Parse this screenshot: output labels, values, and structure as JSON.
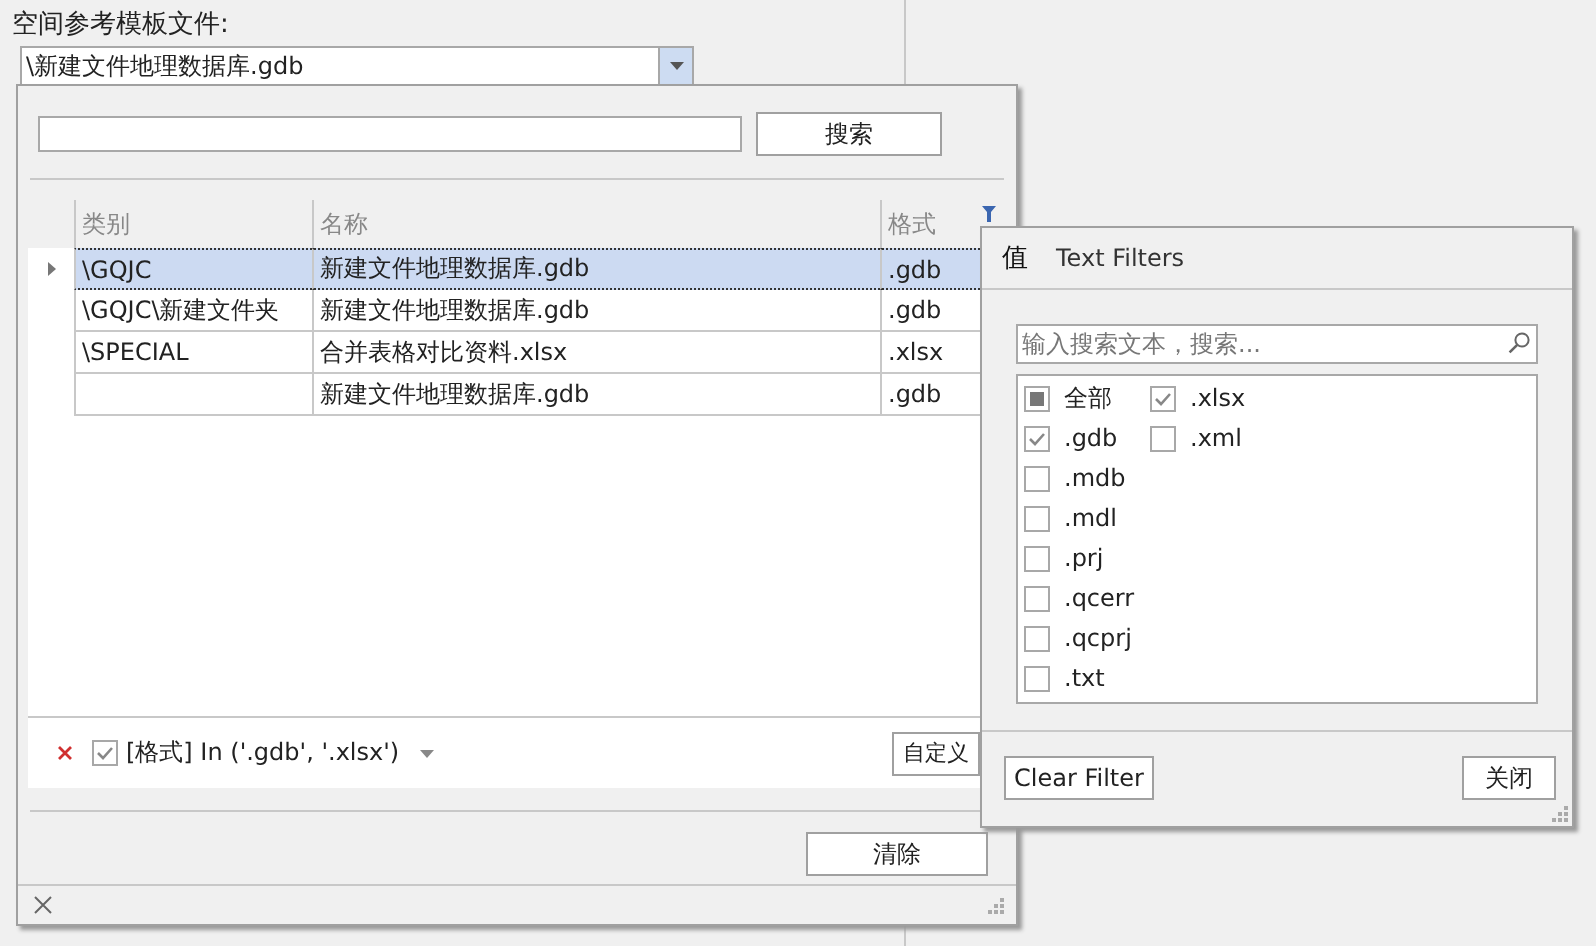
{
  "form": {
    "label": "空间参考模板文件:",
    "combo_value": "\\新建文件地理数据库.gdb"
  },
  "dropdown": {
    "search": {
      "button": "搜索"
    },
    "table": {
      "columns": [
        {
          "label": "类别",
          "filtered": false
        },
        {
          "label": "名称",
          "filtered": false
        },
        {
          "label": "格式",
          "filtered": true
        }
      ],
      "rows": [
        {
          "cells": [
            "\\GQJC",
            "新建文件地理数据库.gdb",
            ".gdb"
          ],
          "selected": true
        },
        {
          "cells": [
            "\\GQJC\\新建文件夹",
            "新建文件地理数据库.gdb",
            ".gdb"
          ],
          "selected": false
        },
        {
          "cells": [
            "\\SPECIAL",
            "合并表格对比资料.xlsx",
            ".xlsx"
          ],
          "selected": false
        },
        {
          "cells": [
            "",
            "新建文件地理数据库.gdb",
            ".gdb"
          ],
          "selected": false
        }
      ]
    },
    "filter_bar": {
      "enabled": true,
      "expression": "[格式] In ('.gdb', '.xlsx')",
      "customize_button": "自定义"
    },
    "clear_button": "清除"
  },
  "filter_popup": {
    "tabs": [
      {
        "label": "值",
        "selected": true
      },
      {
        "label": "Text Filters",
        "selected": false
      }
    ],
    "search_placeholder": "输入搜索文本，搜索...",
    "values": [
      {
        "label": "全部",
        "checked": false,
        "partial": true
      },
      {
        "label": ".gdb",
        "checked": true,
        "partial": false
      },
      {
        "label": ".mdb",
        "checked": false,
        "partial": false
      },
      {
        "label": ".mdl",
        "checked": false,
        "partial": false
      },
      {
        "label": ".prj",
        "checked": false,
        "partial": false
      },
      {
        "label": ".qcerr",
        "checked": false,
        "partial": false
      },
      {
        "label": ".qcprj",
        "checked": false,
        "partial": false
      },
      {
        "label": ".txt",
        "checked": false,
        "partial": false
      },
      {
        "label": ".xlsx",
        "checked": true,
        "partial": false
      },
      {
        "label": ".xml",
        "checked": false,
        "partial": false
      }
    ],
    "clear_button": "Clear Filter",
    "close_button": "关闭"
  }
}
